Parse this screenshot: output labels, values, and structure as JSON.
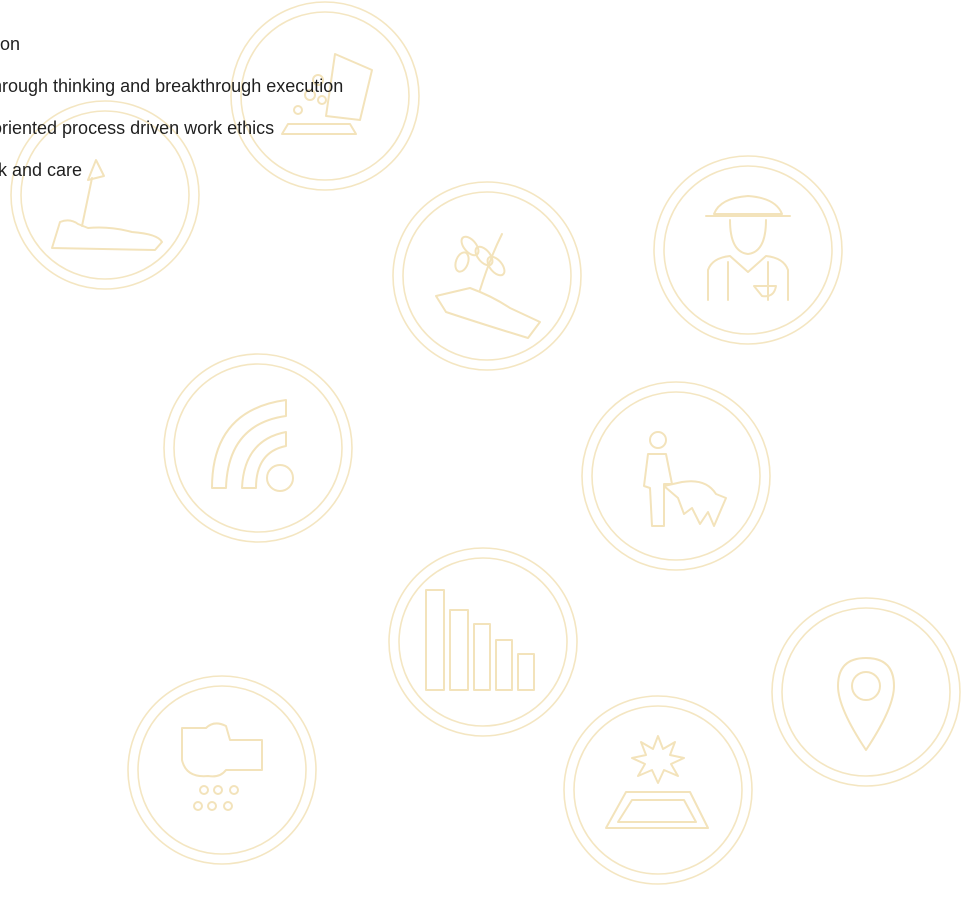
{
  "text_lines": [
    "on",
    "hrough thinking and breakthrough execution",
    " oriented process driven work ethics",
    "k and care"
  ],
  "colors": {
    "icon_accent": "#f3e3bb",
    "text": "#1f1f1f",
    "background": "#ffffff"
  },
  "icons": [
    "spade-in-soil-icon",
    "seeds-pouring-icon",
    "wheat-in-hand-icon",
    "farmer-icon",
    "signal-icon",
    "person-with-livestock-icon",
    "bar-graph-icon",
    "location-pin-icon",
    "soil-with-rain-icon",
    "sunlight-on-field-icon"
  ]
}
